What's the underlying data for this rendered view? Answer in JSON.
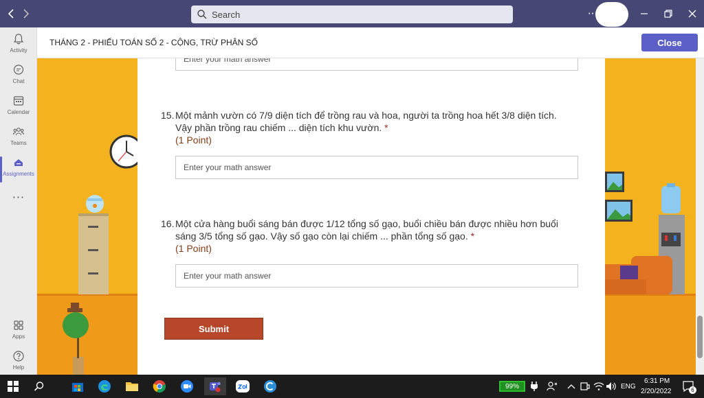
{
  "window": {
    "search_placeholder": "Search",
    "more_label": "···"
  },
  "rail": {
    "items": [
      {
        "label": "Activity",
        "icon": "bell-icon"
      },
      {
        "label": "Chat",
        "icon": "chat-icon"
      },
      {
        "label": "Calendar",
        "icon": "calendar-icon"
      },
      {
        "label": "Teams",
        "icon": "teams-icon"
      },
      {
        "label": "Assignments",
        "icon": "assignments-icon",
        "active": true
      }
    ],
    "more": "···",
    "bottom_items": [
      {
        "label": "Apps",
        "icon": "apps-icon"
      },
      {
        "label": "Help",
        "icon": "help-icon"
      }
    ]
  },
  "header": {
    "title": "THÁNG 2 - PHIẾU TOÁN SỐ 2 - CỘNG, TRỪ PHÂN SỐ",
    "close_label": "Close"
  },
  "form": {
    "answer_placeholder": "Enter your math answer",
    "questions": [
      {
        "number": "15.",
        "text": "Một mảnh vườn có 7/9 diện tích để trồng rau và hoa, người ta trồng hoa hết 3/8 diện tích. Vậy phần trồng rau chiếm ... diện tích khu vườn.",
        "required": "*",
        "points": "(1 Point)"
      },
      {
        "number": "16.",
        "text": "Một cửa hàng buổi sáng bán được 1/12 tổng số gạo, buổi chiều bán được nhiều hơn buổi sáng  3/5 tổng số gạo. Vậy số gạo còn lại chiếm ... phần tổng số gạo.",
        "required": "*",
        "points": "(1 Point)"
      }
    ],
    "submit_label": "Submit"
  },
  "taskbar": {
    "battery": "99%",
    "lang": "ENG",
    "time": "6:31 PM",
    "date": "2/20/2022",
    "notifications": "6"
  },
  "colors": {
    "titlebar": "#464775",
    "accent": "#5b5fc7",
    "submit": "#b7472a",
    "background_yellow": "#f5b21f",
    "background_orange": "#f09a1a"
  }
}
